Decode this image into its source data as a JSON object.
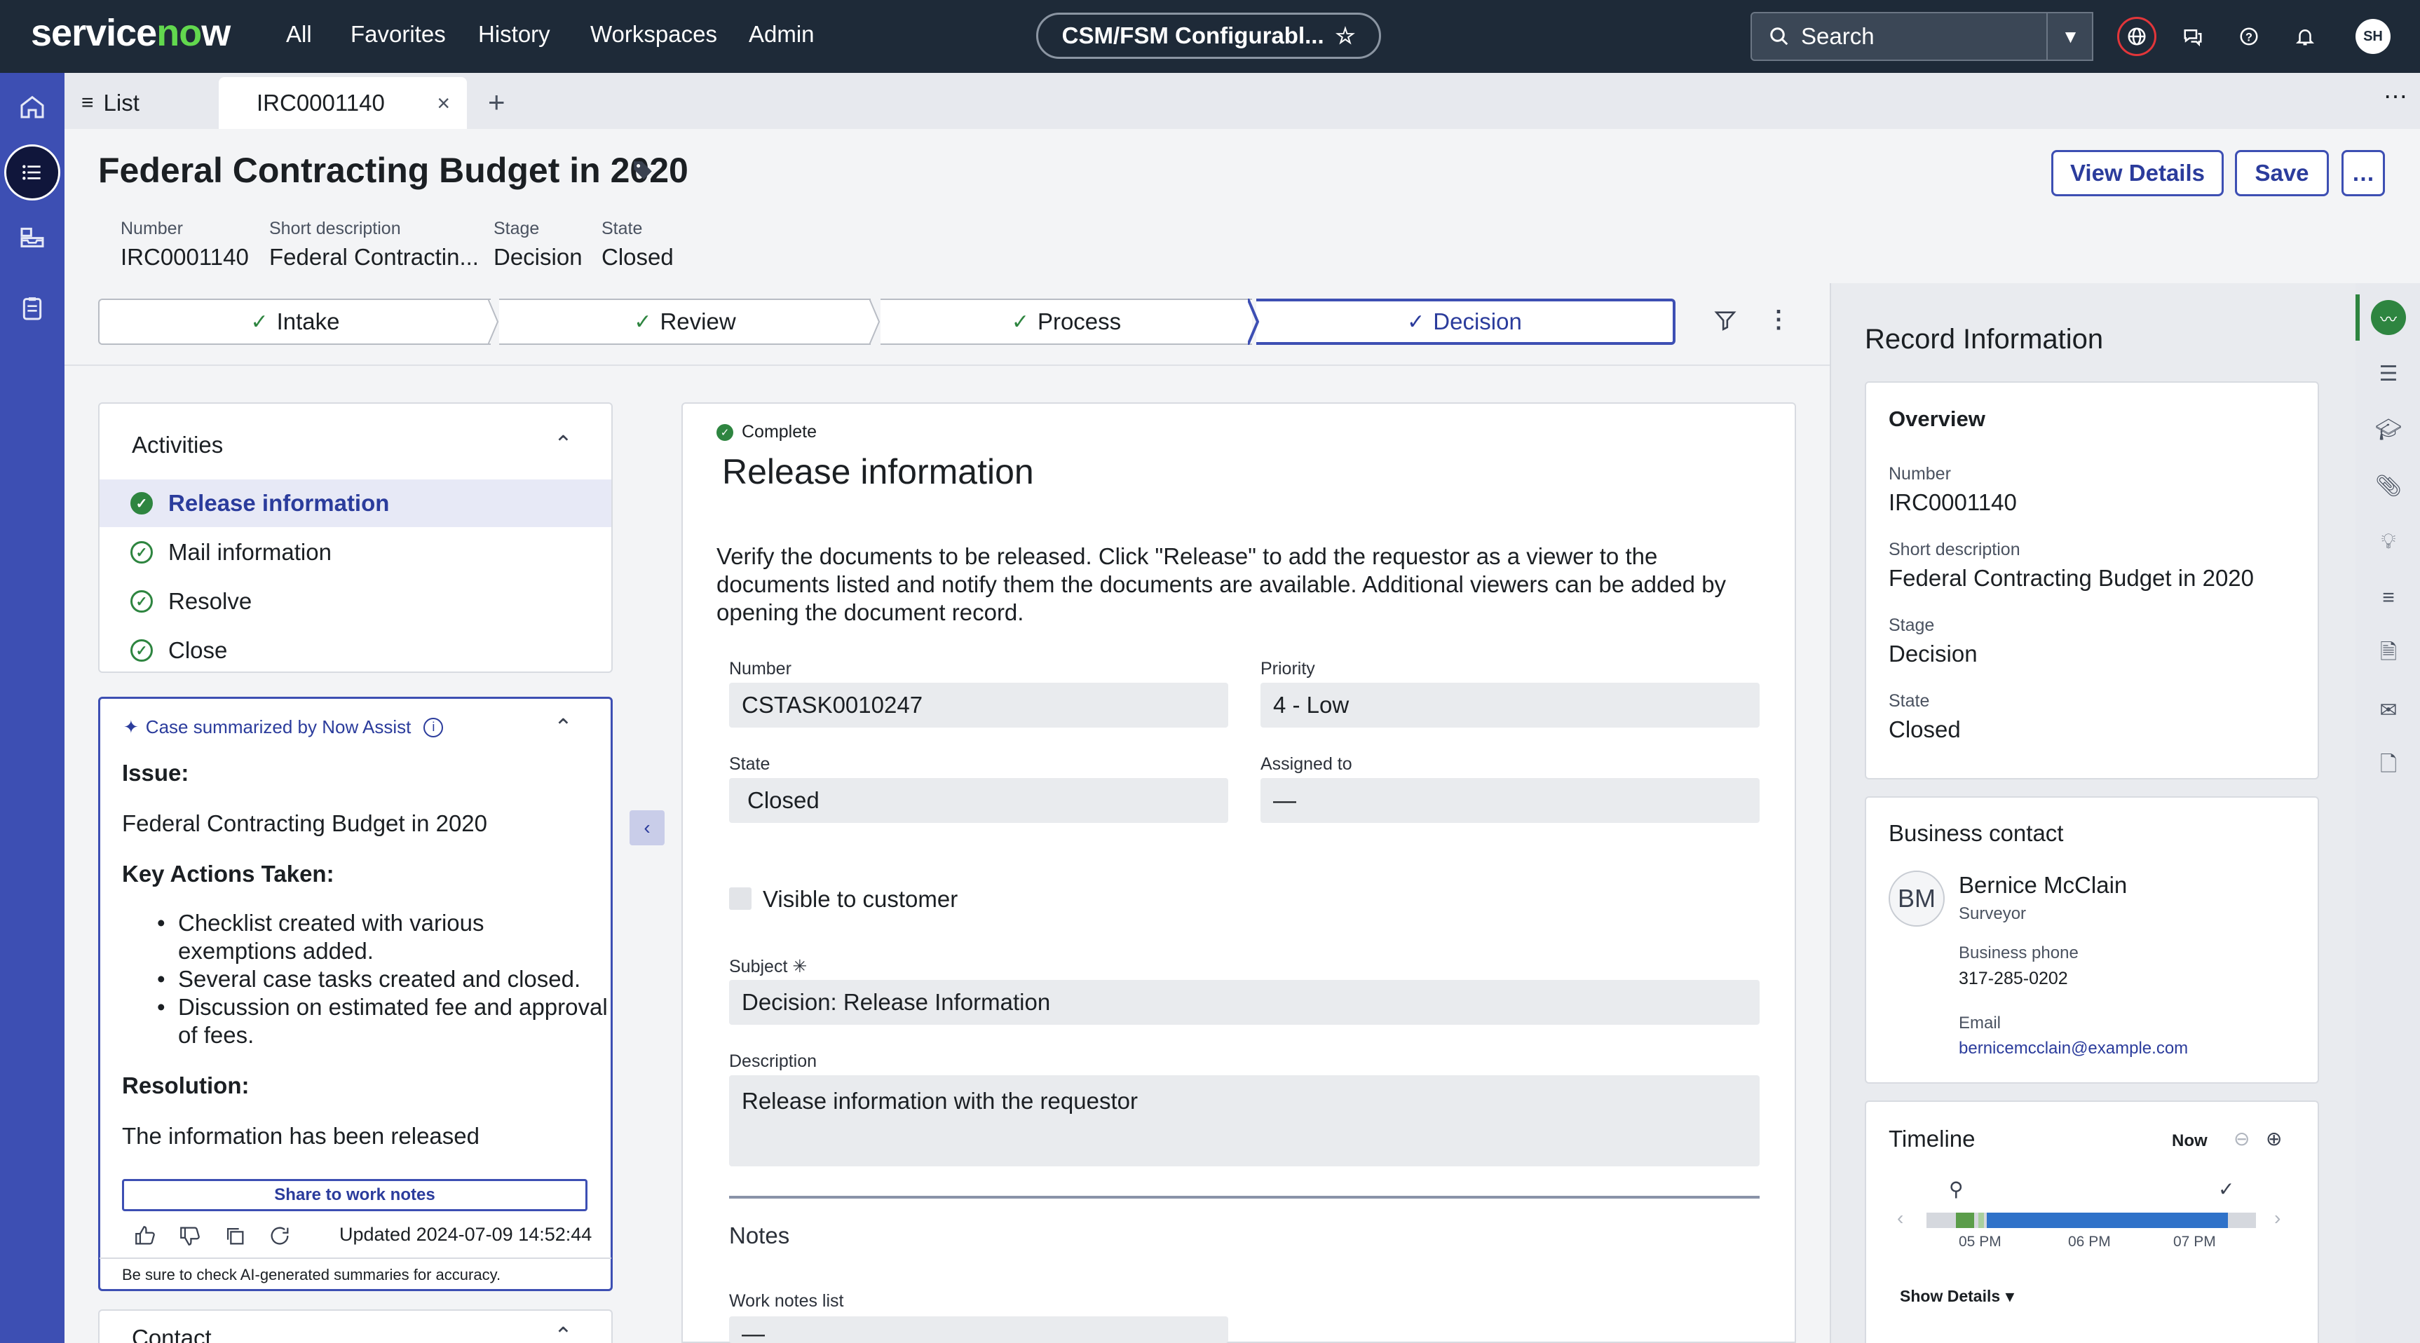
{
  "topnav": {
    "logo": "servicenow",
    "links": [
      "All",
      "Favorites",
      "History",
      "Workspaces",
      "Admin"
    ],
    "context_pill": "CSM/FSM Configurabl...",
    "search_placeholder": "Search",
    "user_initials": "SH"
  },
  "tabs": {
    "list_label": "List",
    "record_tab": "IRC0001140"
  },
  "header": {
    "title": "Federal Contracting Budget in 2020",
    "view_details": "View Details",
    "save": "Save",
    "more": "…",
    "fields": [
      {
        "label": "Number",
        "value": "IRC0001140"
      },
      {
        "label": "Short description",
        "value": "Federal Contractin..."
      },
      {
        "label": "Stage",
        "value": "Decision"
      },
      {
        "label": "State",
        "value": "Closed"
      }
    ]
  },
  "stages": [
    "Intake",
    "Review",
    "Process",
    "Decision"
  ],
  "activities": {
    "title": "Activities",
    "items": [
      "Release information",
      "Mail information",
      "Resolve",
      "Close"
    ]
  },
  "summary": {
    "header": "Case summarized by Now Assist",
    "issue_label": "Issue:",
    "issue": "Federal Contracting Budget in 2020",
    "actions_label": "Key Actions Taken:",
    "bullets": [
      [
        "Checklist created with various",
        "exemptions added."
      ],
      [
        "Several case tasks created and closed."
      ],
      [
        "Discussion on estimated fee and approval",
        "of fees."
      ]
    ],
    "resolution_label": "Resolution:",
    "resolution": "The information has been released",
    "share_button": "Share to work notes",
    "updated": "Updated 2024-07-09 14:52:44",
    "disclaimer": "Be sure to check AI-generated summaries for accuracy."
  },
  "contact_card_title": "Contact",
  "form": {
    "status": "Complete",
    "title": "Release information",
    "instructions_lines": [
      "Verify the documents to be released. Click \"Release\" to add the requestor as a viewer to the",
      "documents listed and notify them the documents are available. Additional viewers can be added by",
      "opening the document record."
    ],
    "number_label": "Number",
    "number": "CSTASK0010247",
    "priority_label": "Priority",
    "priority": "4 - Low",
    "state_label": "State",
    "state": "Closed",
    "assigned_label": "Assigned to",
    "assigned": "—",
    "visible_label": "Visible to customer",
    "subject_label": "Subject",
    "subject": "Decision: Release Information",
    "description_label": "Description",
    "description": "Release information with the requestor",
    "notes_title": "Notes",
    "work_notes_label": "Work notes list",
    "work_notes_value": "—"
  },
  "record_info": {
    "title": "Record Information",
    "overview_title": "Overview",
    "fields": [
      {
        "label": "Number",
        "value": "IRC0001140"
      },
      {
        "label": "Short description",
        "value": "Federal Contracting Budget in 2020"
      },
      {
        "label": "Stage",
        "value": "Decision"
      },
      {
        "label": "State",
        "value": "Closed"
      }
    ],
    "business_contact_title": "Business contact",
    "contact": {
      "initials": "BM",
      "name": "Bernice McClain",
      "role": "Surveyor",
      "phone_label": "Business phone",
      "phone": "317-285-0202",
      "email_label": "Email",
      "email": "bernicemcclain@example.com"
    },
    "timeline": {
      "title": "Timeline",
      "now": "Now",
      "ticks": [
        "05 PM",
        "06 PM",
        "07 PM"
      ],
      "show_details": "Show Details"
    }
  },
  "colors": {
    "nav_bg": "#1e2a38",
    "rail_bg": "#3d4fb3",
    "accent": "#2b3c9c",
    "success": "#2e8540"
  }
}
